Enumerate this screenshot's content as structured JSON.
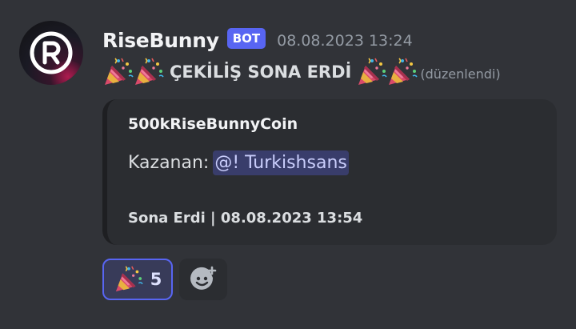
{
  "message": {
    "username": "RiseBunny",
    "bot_tag": "BOT",
    "timestamp": "08.08.2023 13:24",
    "content": "ÇEKİLİŞ SONA ERDİ",
    "edited_label": "(düzenlendi)"
  },
  "embed": {
    "title": "500kRiseBunnyCoin",
    "winner_label": "Kazanan:",
    "winner_mention": "@! Turkishsans",
    "footer": "Sona Erdi | 08.08.2023 13:54"
  },
  "reactions": [
    {
      "emoji": "party-popper",
      "count": "5"
    }
  ],
  "icons": {
    "avatar": "registered-r-logo",
    "content_emoji": "party-popper",
    "add_reaction": "add-reaction-smiley-icon"
  },
  "colors": {
    "background": "#313338",
    "embed_background": "#2b2d31",
    "bot_tag": "#5865f2",
    "mention_background": "#4a4e8f",
    "reaction_border": "#5865f2"
  }
}
